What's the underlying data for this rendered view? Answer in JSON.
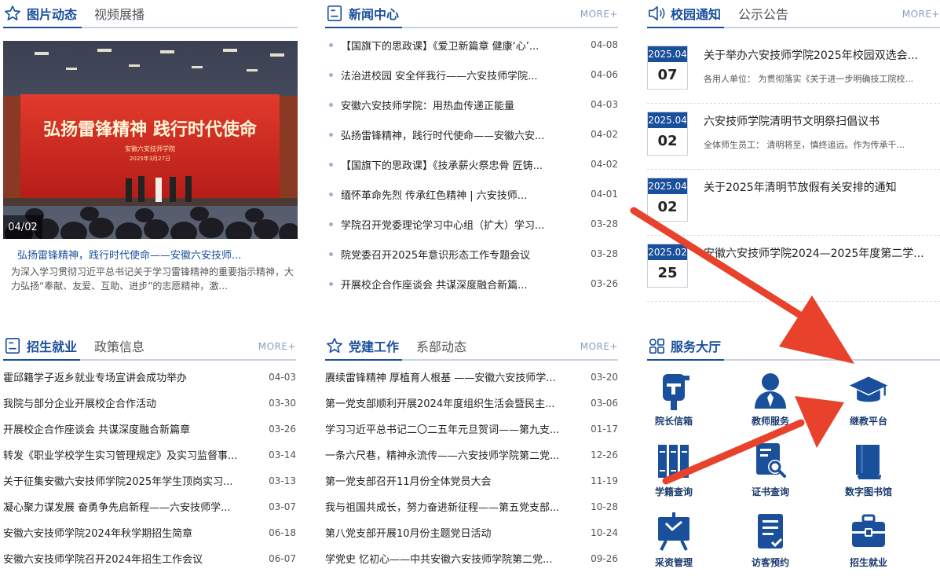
{
  "photos": {
    "title": "图片动态",
    "tab": "视频展播",
    "date_badge": "04/02",
    "caption": "弘扬雷锋精神，践行时代使命——安徽六安技师...",
    "description": "为深入学习贯彻习近平总书记关于学习雷锋精神的重要指示精神，大力弘扬“奉献、友爱、互助、进步”的志愿精神，激...",
    "banner_main": "弘扬雷锋精神 践行时代使命",
    "banner_sub": "安徽六安技师学院",
    "banner_date": "2025年3月27日"
  },
  "news": {
    "title": "新闻中心",
    "more": "MORE+",
    "items": [
      {
        "text": "【国旗下的思政课】《爱卫新篇章 健康‘心’...",
        "date": "04-08"
      },
      {
        "text": "法治进校园 安全伴我行——六安技师学院...",
        "date": "04-06"
      },
      {
        "text": "安徽六安技师学院：用热血传递正能量",
        "date": "04-03"
      },
      {
        "text": "弘扬雷锋精神，践行时代使命——安徽六安...",
        "date": "04-02"
      },
      {
        "text": "【国旗下的思政课】《技承薪火祭忠骨 匠铸...",
        "date": "04-02"
      },
      {
        "text": "缅怀革命先烈 传承红色精神 | 六安技师...",
        "date": "04-01"
      },
      {
        "text": "学院召开党委理论学习中心组（扩大）学习...",
        "date": "03-28"
      },
      {
        "text": "院党委召开2025年意识形态工作专题会议",
        "date": "03-28"
      },
      {
        "text": "开展校企合作座谈会 共谋深度融合新篇...",
        "date": "03-26"
      }
    ]
  },
  "notices": {
    "title": "校园通知",
    "tab": "公示公告",
    "more": "MORE+",
    "items": [
      {
        "ym": "2025.04",
        "day": "07",
        "title": "关于举办六安技师学院2025年校园双选会...",
        "desc": "各用人单位：    为贯彻落实《关于进一步明确技工院校..."
      },
      {
        "ym": "2025.04",
        "day": "02",
        "title": "六安技师学院清明节文明祭扫倡议书",
        "desc": "全体师生员工：      清明将至，慎终追远。作为传承千..."
      },
      {
        "ym": "2025.04",
        "day": "02",
        "title": "关于2025年清明节放假有关安排的通知",
        "desc": ""
      },
      {
        "ym": "2025.02",
        "day": "25",
        "title": "安徽六安技师学院2024—2025年度第二学...",
        "desc": ""
      }
    ]
  },
  "admission": {
    "title": "招生就业",
    "tab": "政策信息",
    "more": "MORE+",
    "items": [
      {
        "text": "霍邱籍学子返乡就业专场宣讲会成功举办",
        "date": "04-03"
      },
      {
        "text": "我院与部分企业开展校企合作活动",
        "date": "03-30"
      },
      {
        "text": "开展校企合作座谈会 共谋深度融合新篇章",
        "date": "03-26"
      },
      {
        "text": "转发《职业学校学生实习管理规定》及实习监督事...",
        "date": "03-14"
      },
      {
        "text": "关于征集安徽六安技师学院2025年学生顶岗实习...",
        "date": "03-13"
      },
      {
        "text": "凝心聚力谋发展 奋勇争先启新程——六安技师学...",
        "date": "03-07"
      },
      {
        "text": "安徽六安技师学院2024年秋学期招生简章",
        "date": "06-18"
      },
      {
        "text": "安徽六安技师学院召开2024年招生工作会议",
        "date": "06-07"
      }
    ]
  },
  "party": {
    "title": "党建工作",
    "tab": "系部动态",
    "more": "MORE+",
    "items": [
      {
        "text": "赓续雷锋精神 厚植育人根基 ——安徽六安技师学...",
        "date": "03-20"
      },
      {
        "text": "第一党支部顺利开展2024年度组织生活会暨民主...",
        "date": "03-06"
      },
      {
        "text": "学习习近平总书记二〇二五年元旦贺词——第九支...",
        "date": "01-17"
      },
      {
        "text": "一条六尺巷，精神永流传——六安技师学院第二党...",
        "date": "12-26"
      },
      {
        "text": "第一党支部召开11月份全体党员大会",
        "date": "11-19"
      },
      {
        "text": "我与祖国共成长，努力奋进新征程——第五党支部...",
        "date": "10-28"
      },
      {
        "text": "第八党支部开展10月份主题党日活动",
        "date": "10-24"
      },
      {
        "text": "学党史 忆初心——中共安徽六安技师学院第二党...",
        "date": "09-26"
      }
    ]
  },
  "services": {
    "title": "服务大厅",
    "items": [
      {
        "label": "院长信箱",
        "icon": "mailbox-icon"
      },
      {
        "label": "教师服务",
        "icon": "teacher-icon"
      },
      {
        "label": "继教平台",
        "icon": "graduation-cap-icon"
      },
      {
        "label": "学籍查询",
        "icon": "bookshelf-icon"
      },
      {
        "label": "证书查询",
        "icon": "certificate-search-icon"
      },
      {
        "label": "数字图书馆",
        "icon": "book-icon"
      },
      {
        "label": "采资管理",
        "icon": "easel-icon"
      },
      {
        "label": "访客预约",
        "icon": "document-icon"
      },
      {
        "label": "招生就业",
        "icon": "briefcase-icon"
      }
    ]
  },
  "colors": {
    "brand": "#1a4f9c",
    "arrow": "#e8412c"
  }
}
